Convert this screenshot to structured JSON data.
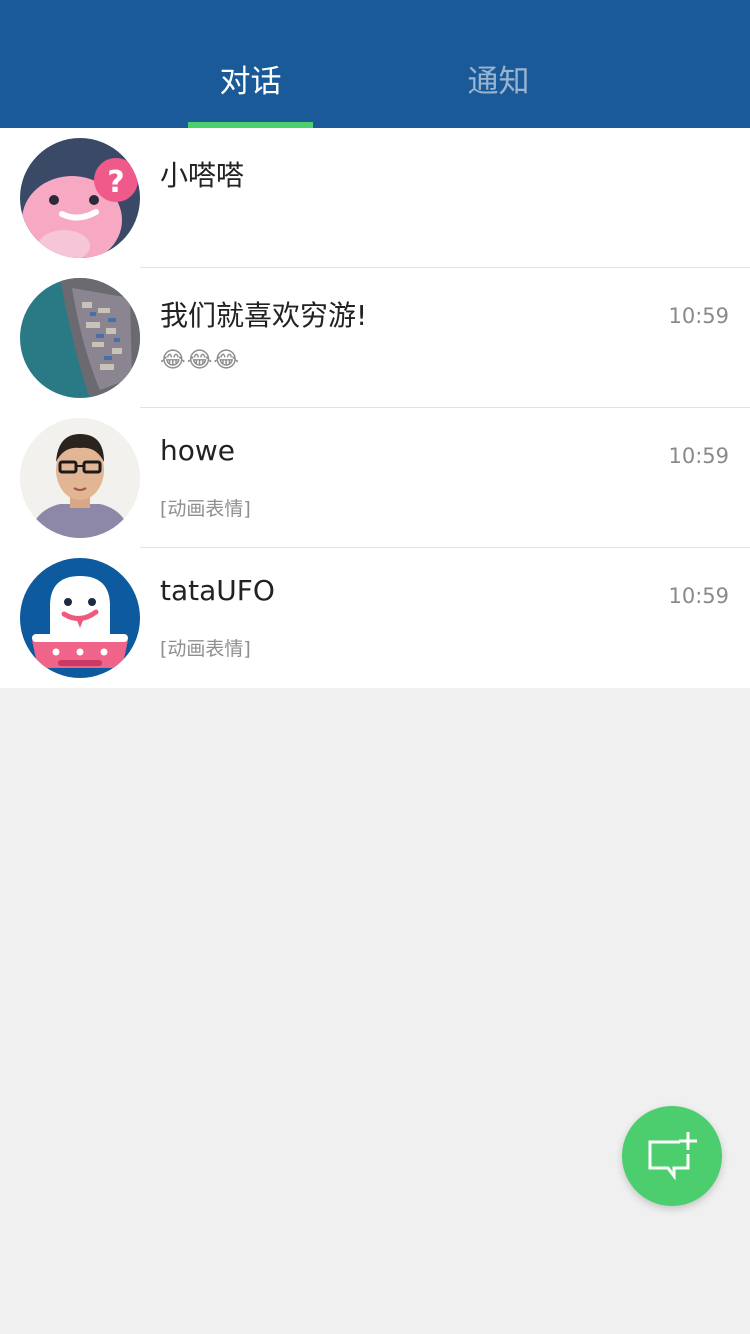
{
  "tabs": {
    "conversations": "对话",
    "notifications": "通知"
  },
  "conversations": [
    {
      "name": "小嗒嗒",
      "time": "",
      "preview": ""
    },
    {
      "name": "我们就喜欢穷游!",
      "time": "10:59",
      "preview": "😂😂😂"
    },
    {
      "name": "howe",
      "time": "10:59",
      "preview": "[动画表情]"
    },
    {
      "name": "tataUFO",
      "time": "10:59",
      "preview": "[动画表情]"
    }
  ],
  "fab": {
    "icon": "new-message-icon"
  },
  "colors": {
    "header": "#1b5a99",
    "accent": "#4ccd6e",
    "background": "#f0f0f0"
  }
}
